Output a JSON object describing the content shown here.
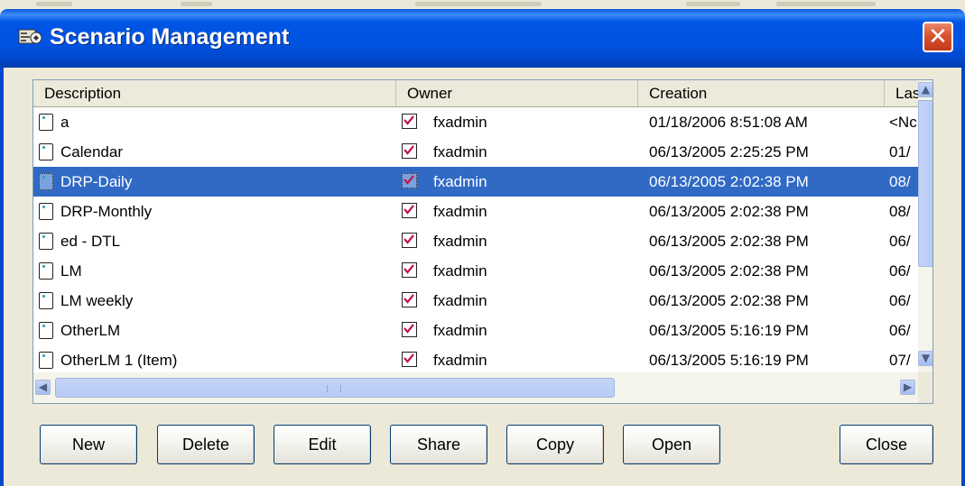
{
  "window": {
    "title": "Scenario Management",
    "close_glyph": "✕",
    "colors": {
      "title_bar": "#0053e1",
      "selection": "#316ac5",
      "close_button": "#d8522e"
    }
  },
  "list": {
    "columns": [
      "Description",
      "Owner",
      "Creation",
      "Las"
    ],
    "rows": [
      {
        "description": "a",
        "owner": "fxadmin",
        "creation": "01/18/2006 8:51:08 AM",
        "last": "<Nc",
        "selected": false
      },
      {
        "description": "Calendar",
        "owner": "fxadmin",
        "creation": "06/13/2005 2:25:25 PM",
        "last": "01/",
        "selected": false
      },
      {
        "description": "DRP-Daily",
        "owner": "fxadmin",
        "creation": "06/13/2005 2:02:38 PM",
        "last": "08/",
        "selected": true
      },
      {
        "description": "DRP-Monthly",
        "owner": "fxadmin",
        "creation": "06/13/2005 2:02:38 PM",
        "last": "08/",
        "selected": false
      },
      {
        "description": "ed - DTL",
        "owner": "fxadmin",
        "creation": "06/13/2005 2:02:38 PM",
        "last": "06/",
        "selected": false
      },
      {
        "description": "LM",
        "owner": "fxadmin",
        "creation": "06/13/2005 2:02:38 PM",
        "last": "06/",
        "selected": false
      },
      {
        "description": "LM weekly",
        "owner": "fxadmin",
        "creation": "06/13/2005 2:02:38 PM",
        "last": "06/",
        "selected": false
      },
      {
        "description": "OtherLM",
        "owner": "fxadmin",
        "creation": "06/13/2005 5:16:19 PM",
        "last": "06/",
        "selected": false
      },
      {
        "description": "OtherLM 1 (Item)",
        "owner": "fxadmin",
        "creation": "06/13/2005 5:16:19 PM",
        "last": "07/",
        "selected": false
      }
    ]
  },
  "scrollbar": {
    "up": "▲",
    "down": "▼",
    "left": "◀",
    "right": "▶"
  },
  "buttons": {
    "new": "New",
    "delete": "Delete",
    "edit": "Edit",
    "share": "Share",
    "copy": "Copy",
    "open": "Open",
    "close": "Close"
  }
}
